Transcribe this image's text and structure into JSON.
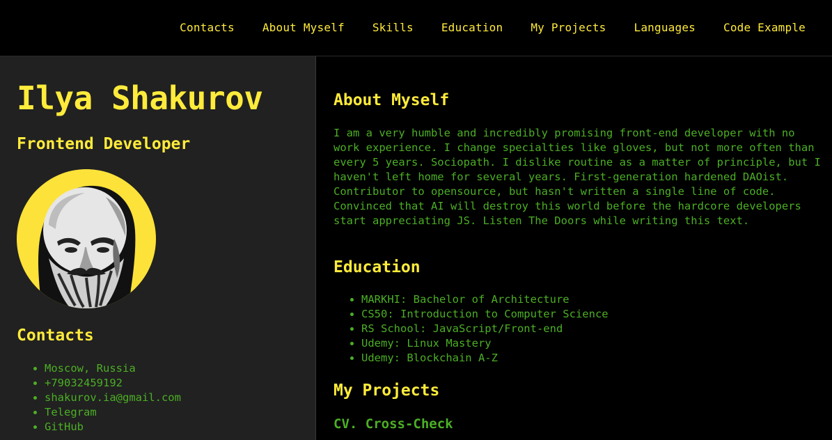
{
  "nav": {
    "items": [
      {
        "label": "Contacts"
      },
      {
        "label": "About Myself"
      },
      {
        "label": "Skills"
      },
      {
        "label": "Education"
      },
      {
        "label": "My Projects"
      },
      {
        "label": "Languages"
      },
      {
        "label": "Code Example"
      }
    ]
  },
  "sidebar": {
    "name": "Ilya Shakurov",
    "role": "Frontend Developer",
    "avatar_icon": "bearded-man-portrait",
    "contacts_heading": "Contacts",
    "contacts": [
      {
        "label": "Moscow, Russia"
      },
      {
        "label": "+79032459192"
      },
      {
        "label": "shakurov.ia@gmail.com"
      },
      {
        "label": "Telegram"
      },
      {
        "label": "GitHub"
      }
    ]
  },
  "main": {
    "about_heading": "About Myself",
    "about_text": "I am a very humble and incredibly promising front-end developer with no work experience. I change specialties like gloves, but not more often than every 5 years. Sociopath. I dislike routine as a matter of principle, but I haven't left home for several years. First-generation hardened DAOist. Contributor to opensource, but hasn't written a single line of code. Convinced that AI will destroy this world before the hardcore developers start appreciating JS. Listen The Doors while writing this text.",
    "education_heading": "Education",
    "education": [
      {
        "label": "MARKHI: Bachelor of Architecture"
      },
      {
        "label": "CS50: Introduction to Computer Science"
      },
      {
        "label": "RS School: JavaScript/Front-end"
      },
      {
        "label": "Udemy: Linux Mastery"
      },
      {
        "label": "Udemy: Blockchain A-Z"
      }
    ],
    "projects_heading": "My Projects",
    "first_project": "CV. Cross-Check"
  },
  "colors": {
    "accent_yellow": "#ffeb3b",
    "text_green": "#4caf25",
    "sidebar_bg": "#212121",
    "page_bg": "#000000"
  }
}
